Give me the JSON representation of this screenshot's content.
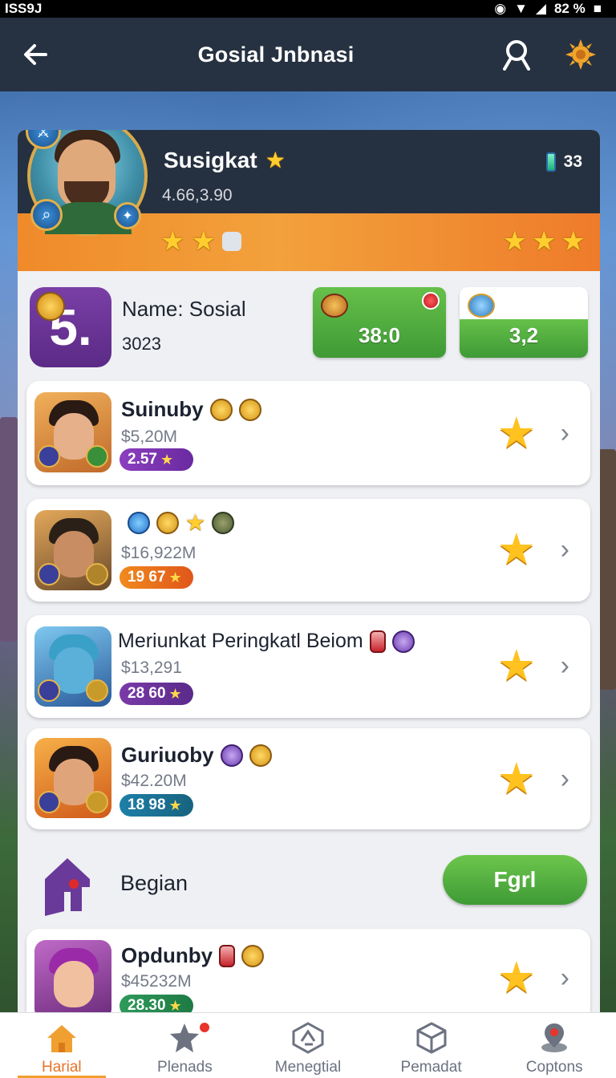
{
  "status_bar": {
    "left": "ISS9J",
    "battery": "82 %"
  },
  "app_bar": {
    "title": "Gosial Jnbnasi"
  },
  "profile": {
    "name": "Susigkat",
    "sub": "4.66,3.90",
    "coins": "33"
  },
  "info": {
    "level": "5.",
    "name": "Name: Sosial",
    "number": "3023",
    "stat_a": "38:0",
    "stat_b": "3,2"
  },
  "cards": [
    {
      "title": "Suinuby",
      "price": "$5,20M",
      "pill": "2.57"
    },
    {
      "title": "",
      "price": "$16,922M",
      "pill": "19 67"
    },
    {
      "title": "Meriunkat Peringkatl Beiom",
      "price": "$13,291",
      "pill": "28 60"
    },
    {
      "title": "Guriuoby",
      "price": "$42.20M",
      "pill": "18 98"
    },
    {
      "title": "Opdunby",
      "price": "$45232M",
      "pill": "28.30"
    }
  ],
  "section": {
    "label": "Begian",
    "button": "Fgrl"
  },
  "bottom_nav": [
    {
      "label": "Harial"
    },
    {
      "label": "Plenads"
    },
    {
      "label": "Menegtial"
    },
    {
      "label": "Pemadat"
    },
    {
      "label": "Coptons"
    }
  ],
  "colors": {
    "accent_orange": "#f08a2a",
    "accent_green": "#4fae3e",
    "appbar": "#263141"
  }
}
